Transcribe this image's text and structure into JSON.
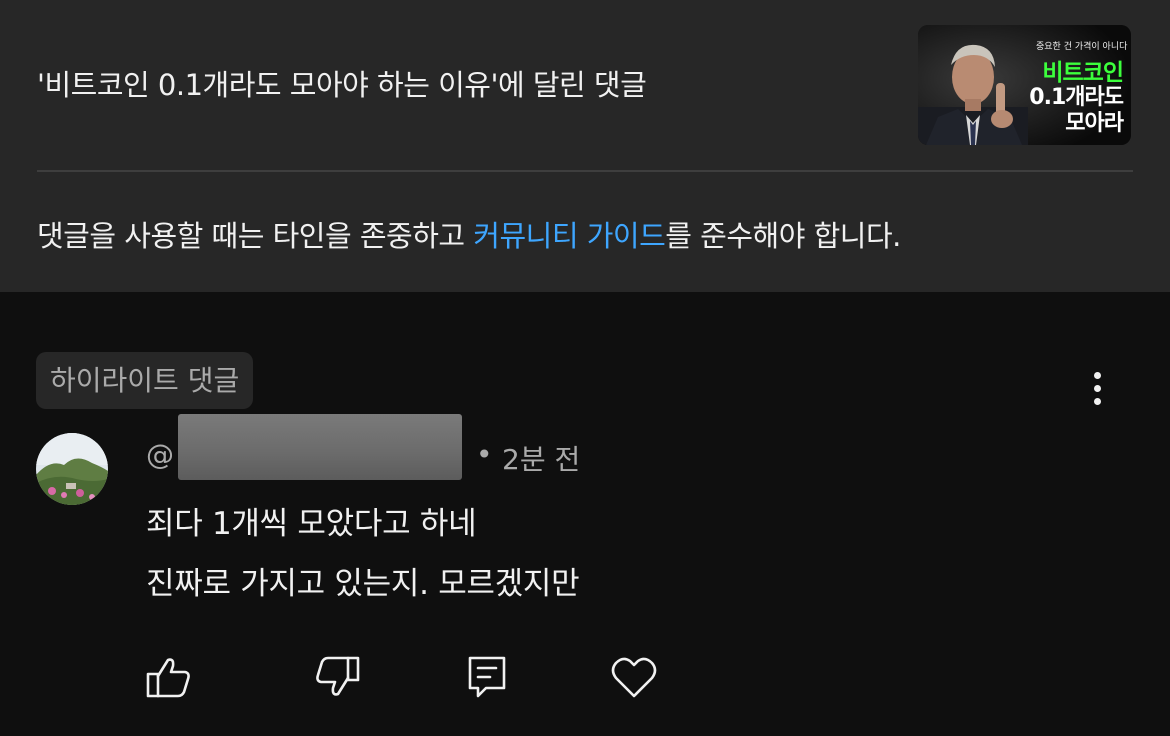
{
  "header": {
    "video_title": "'비트코인 0.1개라도 모아야 하는 이유'에 달린 댓글",
    "thumbnail": {
      "small_caption": "중요한 건 가격이 아니다",
      "line1": "비트코인",
      "line2": "0.1개라도",
      "line3": "모아라",
      "accent_color": "#3cff3c"
    },
    "guide_prefix": "댓글을 사용할 때는 타인을 존중하고 ",
    "guide_link": "커뮤니티 가이드",
    "guide_suffix": "를 준수해야 합니다."
  },
  "comment": {
    "highlight_label": "하이라이트 댓글",
    "at_symbol": "@",
    "separator": "•",
    "time": "2분 전",
    "lines": [
      "죄다 1개씩 모았다고 하네",
      "진짜로 가지고 있는지. 모르겠지만"
    ],
    "actions": [
      "like-icon",
      "dislike-icon",
      "reply-icon",
      "heart-icon"
    ],
    "menu_icon": "more-vert-icon"
  },
  "colors": {
    "header_bg": "#272727",
    "page_bg": "#0f0f0f",
    "link": "#3ea6ff",
    "secondary_text": "#aaaaaa"
  }
}
